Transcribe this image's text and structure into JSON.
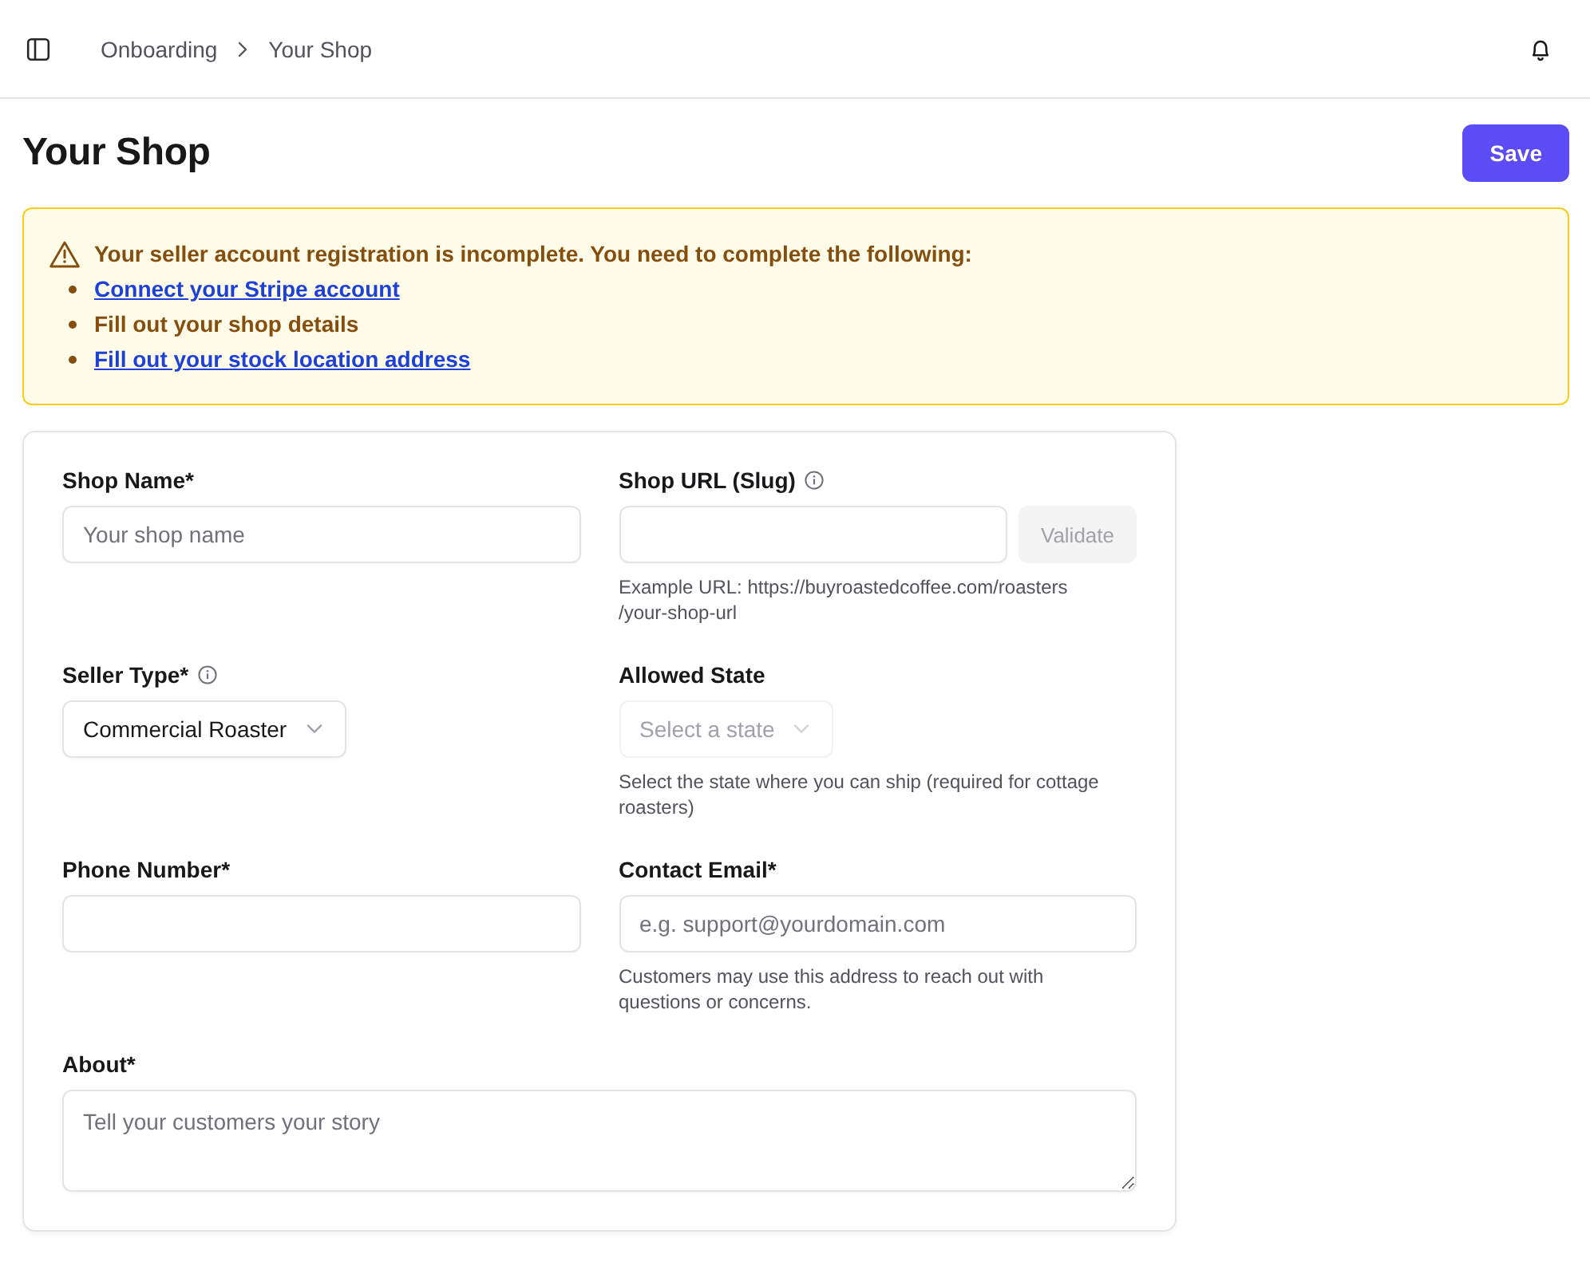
{
  "header": {
    "breadcrumbs": [
      "Onboarding",
      "Your Shop"
    ]
  },
  "page": {
    "title": "Your Shop",
    "save_button": "Save"
  },
  "alert": {
    "kind": "warning",
    "message": "Your seller account registration is incomplete. You need to complete the following:",
    "items": [
      {
        "kind": "link",
        "text": "Connect your Stripe account"
      },
      {
        "kind": "text",
        "text": "Fill out your shop details"
      },
      {
        "kind": "link",
        "text": "Fill out your stock location address"
      }
    ]
  },
  "form": {
    "fields": [
      {
        "kind": "text",
        "label": "Shop Name*",
        "placeholder": "Your shop name"
      },
      {
        "kind": "text_with_button",
        "label": "Shop URL (Slug)",
        "info": true,
        "button": {
          "label": "Validate",
          "disabled": true
        },
        "help": "Example URL: https://buyroastedcoffee.com/roasters\n/your-shop-url"
      },
      {
        "kind": "select",
        "label": "Seller Type*",
        "info": true,
        "value": "Commercial Roaster",
        "disabled": false
      },
      {
        "kind": "select",
        "label": "Allowed State",
        "placeholder": "Select a state",
        "disabled": true,
        "help": "Select the state where you can ship (required for cottage\nroasters)"
      },
      {
        "kind": "text",
        "label": "Phone Number*"
      },
      {
        "kind": "text",
        "label": "Contact Email*",
        "placeholder": "e.g. support@yourdomain.com",
        "help": "Customers may use this address to reach out with\nquestions or concerns."
      },
      {
        "kind": "textarea",
        "label": "About*",
        "placeholder": "Tell your customers your story"
      }
    ]
  }
}
